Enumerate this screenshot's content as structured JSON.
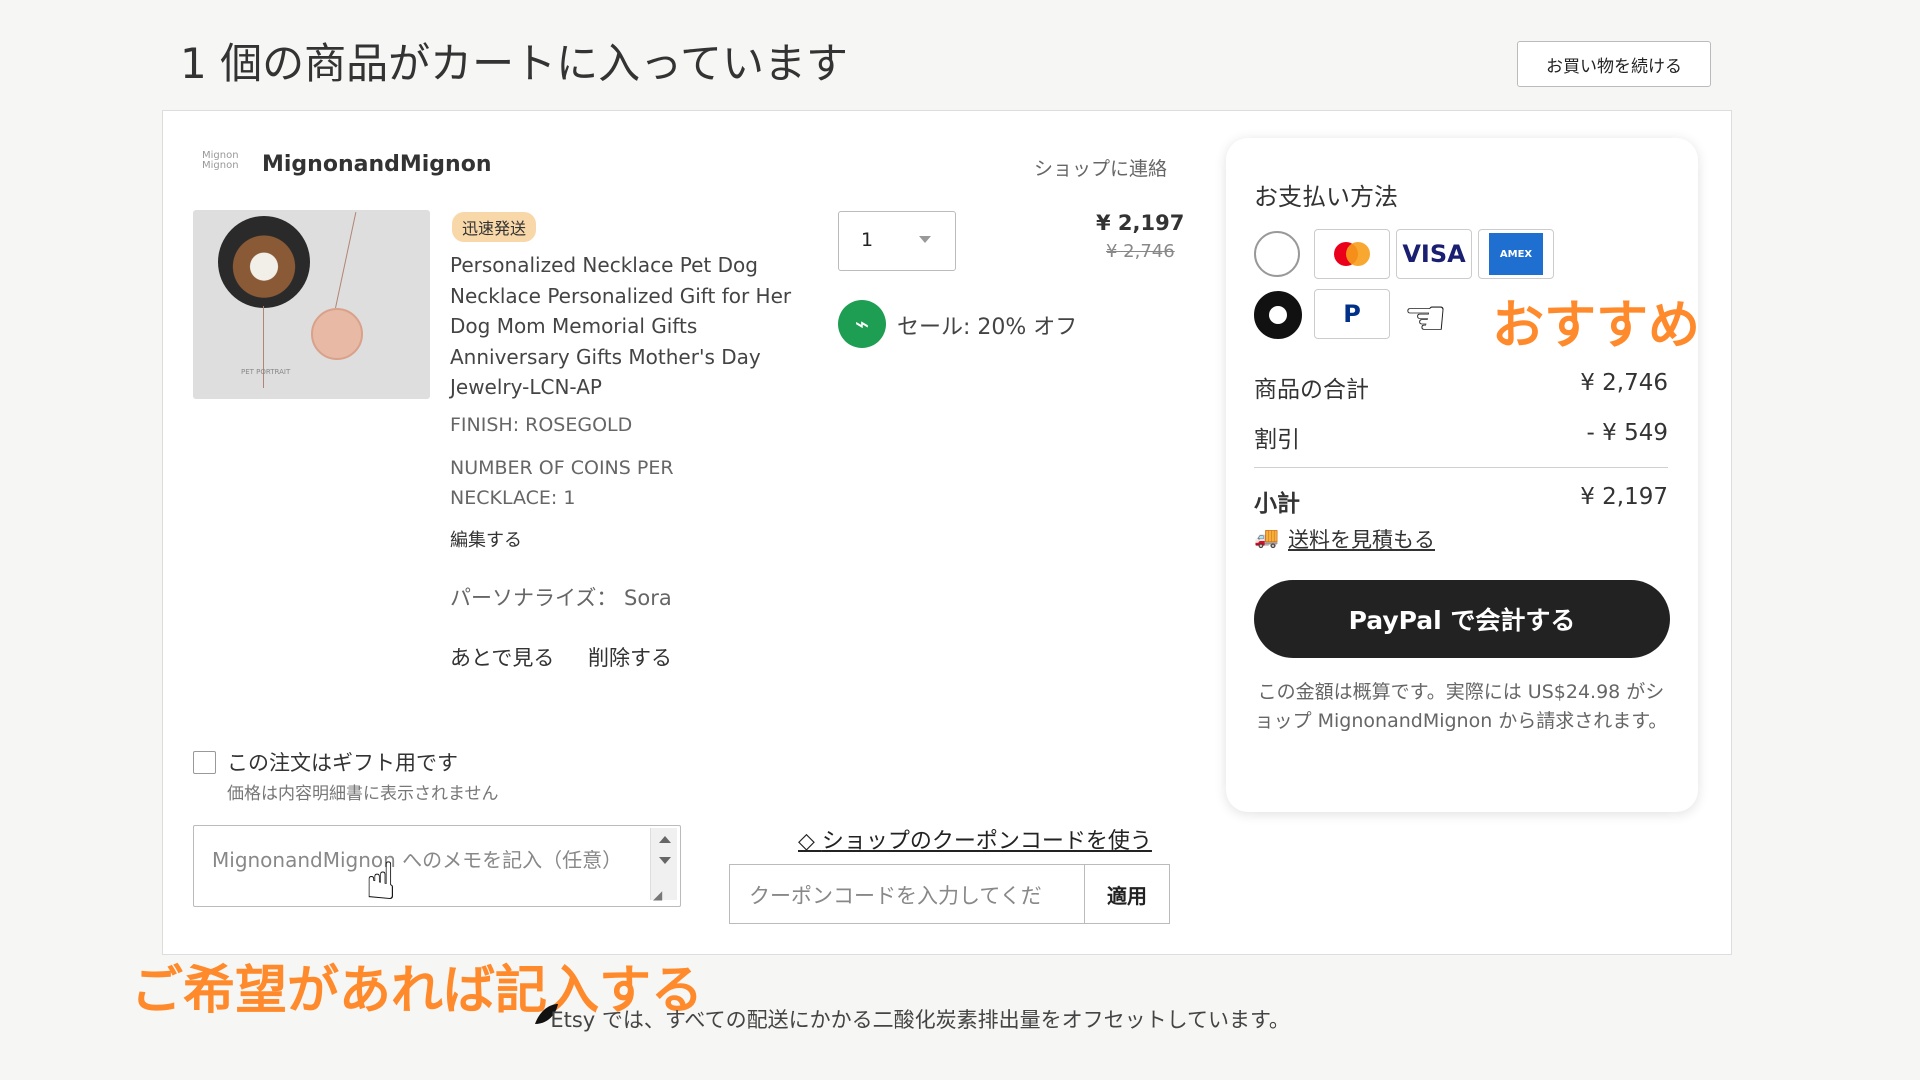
{
  "page": {
    "title": "1 個の商品がカートに入っています",
    "continue_shopping": "お買い物を続ける"
  },
  "shop": {
    "logo_text": "Mignon Mignon",
    "name": "MignonandMignon",
    "contact": "ショップに連絡"
  },
  "item": {
    "badge": "迅速発送",
    "title": "Personalized Necklace Pet Dog Necklace Personalized Gift for Her Dog Mom Memorial Gifts Anniversary Gifts Mother's Day Jewelry-LCN-AP",
    "image_caption": "PET PORTRAIT",
    "variants": [
      "FINISH: ROSEGOLD",
      "NUMBER OF COINS PER NECKLACE: 1"
    ],
    "edit": "編集する",
    "personalization": "パーソナライズ： Sora",
    "save_later": "あとで見る",
    "remove": "削除する",
    "quantity": "1",
    "price": "¥ 2,197",
    "original_price": "¥ 2,746",
    "sale_label": "セール: 20% オフ",
    "sale_icon": "tag-icon"
  },
  "gift": {
    "label": "この注文はギフト用です",
    "note": "価格は内容明細書に表示されません"
  },
  "memo": {
    "placeholder": "MignonandMignon へのメモを記入（任意）"
  },
  "coupon": {
    "link": "ショップのクーポンコードを使う",
    "placeholder": "クーポンコードを入力してくだ",
    "apply": "適用"
  },
  "payment": {
    "heading": "お支払い方法",
    "options": [
      "cards",
      "paypal"
    ],
    "selected": "paypal",
    "logos": [
      "mastercard-icon",
      "visa-icon",
      "amex-icon",
      "paypal-icon"
    ],
    "visa": "VISA",
    "amex": "AMEX",
    "paypal": "PayPal",
    "recommend": "おすすめ"
  },
  "summary": {
    "items_total_label": "商品の合計",
    "items_total_value": "¥ 2,746",
    "discount_label": "割引",
    "discount_value": "- ¥ 549",
    "subtotal_label": "小計",
    "subtotal_value": "¥ 2,197",
    "shipping_link": "送料を見積もる",
    "checkout_button": "PayPal で会計する",
    "estimate_note": "この金額は概算です。実際には US$24.98 がショップ MignonandMignon から請求されます。"
  },
  "annotations": {
    "memo_cta": "ご希望があれば記入する"
  },
  "footer": {
    "note": "Etsy では、すべての配送にかかる二酸化炭素排出量をオフセットしています。"
  },
  "colors": {
    "accent_orange": "#ff8a2c",
    "sale_green": "#1e9e52",
    "checkout_black": "#222222"
  }
}
